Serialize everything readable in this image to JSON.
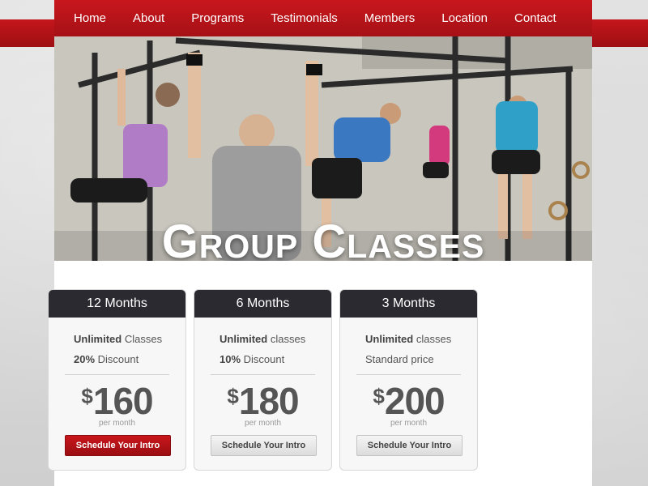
{
  "nav": {
    "items": [
      "Home",
      "About",
      "Programs",
      "Testimonials",
      "Members",
      "Location",
      "Contact"
    ]
  },
  "hero": {
    "title": "Group Classes"
  },
  "plans": [
    {
      "title": "12 Months",
      "feature1_bold": "Unlimited",
      "feature1_rest": " Classes",
      "feature2_bold": "20%",
      "feature2_rest": " Discount",
      "currency": "$",
      "price": "160",
      "per": "per month",
      "button": "Schedule Your Intro"
    },
    {
      "title": "6 Months",
      "feature1_bold": "Unlimited",
      "feature1_rest": " classes",
      "feature2_bold": "10%",
      "feature2_rest": " Discount",
      "currency": "$",
      "price": "180",
      "per": "per month",
      "button": "Schedule Your Intro"
    },
    {
      "title": "3 Months",
      "feature1_bold": "Unlimited",
      "feature1_rest": " classes",
      "feature2_bold": "",
      "feature2_rest": "Standard price",
      "currency": "$",
      "price": "200",
      "per": "per month",
      "button": "Schedule Your Intro"
    }
  ],
  "colors": {
    "brand_red": "#b5141a",
    "card_header": "#2a2a30",
    "background": "#d6d6d6"
  }
}
